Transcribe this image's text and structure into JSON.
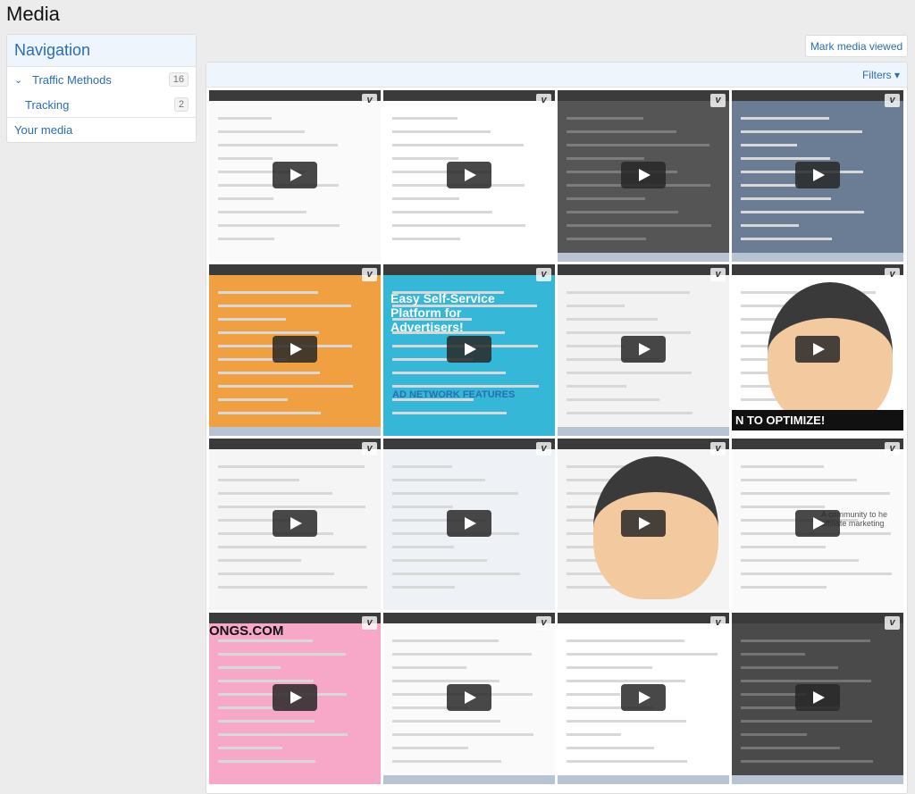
{
  "page": {
    "title": "Media"
  },
  "navigation": {
    "title": "Navigation",
    "items": [
      {
        "label": "Traffic Methods",
        "count": "16",
        "expanded": true
      },
      {
        "label": "Tracking",
        "count": "2"
      },
      {
        "label": "Your media"
      }
    ]
  },
  "actions": {
    "mark_viewed": "Mark media viewed",
    "filters": "Filters ▾"
  },
  "thumb_text": {
    "platform": "Easy Self-Service Platform for Advertisers!",
    "features": "AD NETWORK FEATURES",
    "optimize": "N TO OPTIMIZE!",
    "bongs": "ONGS.COM",
    "community": "A community to he affiliate marketing"
  },
  "media": [
    {
      "theme": "table",
      "icon": "play-icon"
    },
    {
      "theme": "doc"
    },
    {
      "theme": "dark"
    },
    {
      "theme": "desktop"
    },
    {
      "theme": "photos"
    },
    {
      "theme": "platform"
    },
    {
      "theme": "dash"
    },
    {
      "theme": "cartoon-optimize"
    },
    {
      "theme": "chart"
    },
    {
      "theme": "table2"
    },
    {
      "theme": "cartoon"
    },
    {
      "theme": "community"
    },
    {
      "theme": "bongs"
    },
    {
      "theme": "chart2"
    },
    {
      "theme": "table3"
    },
    {
      "theme": "dark2"
    }
  ],
  "colors": {
    "accent": "#2a6db3",
    "header_bg": "#eef5fd"
  }
}
